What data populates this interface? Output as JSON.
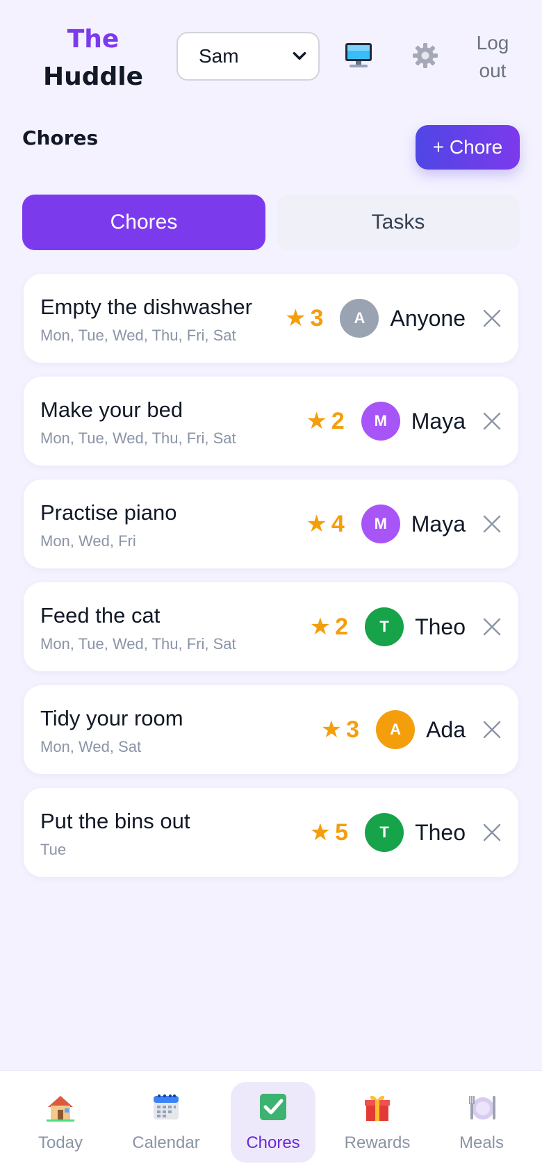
{
  "header": {
    "brand_line1": "The",
    "brand_line2": "Huddle",
    "user_select": {
      "value": "Sam"
    },
    "logout_label": "Log out"
  },
  "section": {
    "title": "Chores",
    "add_button": "+ Chore"
  },
  "tabs": [
    {
      "label": "Chores",
      "active": true
    },
    {
      "label": "Tasks",
      "active": false
    }
  ],
  "chores": [
    {
      "title": "Empty the dishwasher",
      "days": "Mon, Tue, Wed, Thu, Fri, Sat",
      "stars": "3",
      "avatar": "A",
      "avatar_color": "#9aa3b2",
      "assignee": "Anyone"
    },
    {
      "title": "Make your bed",
      "days": "Mon, Tue, Wed, Thu, Fri, Sat",
      "stars": "2",
      "avatar": "M",
      "avatar_color": "#a855f7",
      "assignee": "Maya"
    },
    {
      "title": "Practise piano",
      "days": "Mon, Wed, Fri",
      "stars": "4",
      "avatar": "M",
      "avatar_color": "#a855f7",
      "assignee": "Maya"
    },
    {
      "title": "Feed the cat",
      "days": "Mon, Tue, Wed, Thu, Fri, Sat",
      "stars": "2",
      "avatar": "T",
      "avatar_color": "#16a34a",
      "assignee": "Theo"
    },
    {
      "title": "Tidy your room",
      "days": "Mon, Wed, Sat",
      "stars": "3",
      "avatar": "A",
      "avatar_color": "#f59e0b",
      "assignee": "Ada"
    },
    {
      "title": "Put the bins out",
      "days": "Tue",
      "stars": "5",
      "avatar": "T",
      "avatar_color": "#16a34a",
      "assignee": "Theo"
    }
  ],
  "nav": [
    {
      "label": "Today",
      "icon": "house-icon",
      "active": false
    },
    {
      "label": "Calendar",
      "icon": "calendar-icon",
      "active": false
    },
    {
      "label": "Chores",
      "icon": "checkbox-icon",
      "active": true
    },
    {
      "label": "Rewards",
      "icon": "gift-icon",
      "active": false
    },
    {
      "label": "Meals",
      "icon": "plate-icon",
      "active": false
    }
  ],
  "colors": {
    "accent": "#7c3aed",
    "star": "#f59e0b",
    "background": "#f4f2fe"
  }
}
